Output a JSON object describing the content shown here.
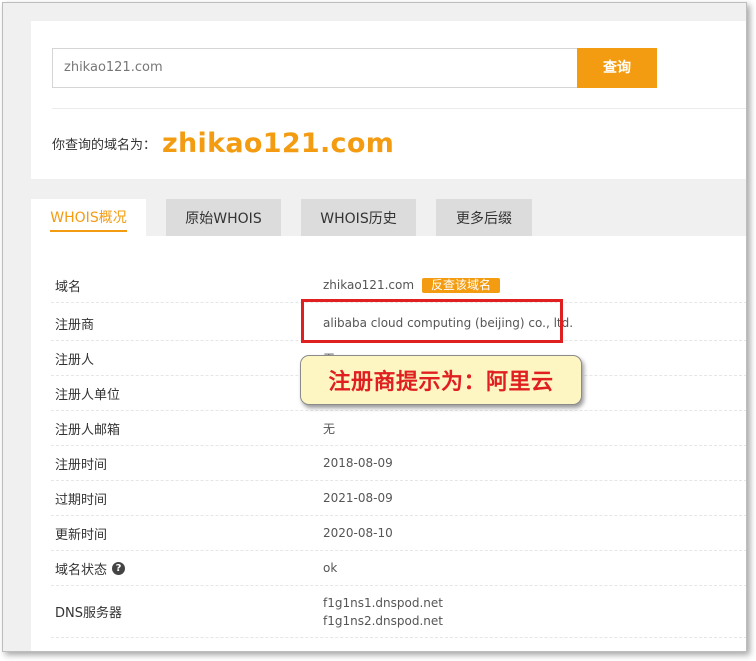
{
  "search": {
    "value": "zhikao121.com",
    "button_label": "查询"
  },
  "result": {
    "prefix": "你查询的域名为：",
    "domain": "zhikao121.com"
  },
  "tabs": [
    {
      "label": "WHOIS概况",
      "active": true
    },
    {
      "label": "原始WHOIS",
      "active": false
    },
    {
      "label": "WHOIS历史",
      "active": false
    },
    {
      "label": "更多后缀",
      "active": false
    }
  ],
  "rows": [
    {
      "label": "域名",
      "value": "zhikao121.com",
      "badge": "反查该域名"
    },
    {
      "label": "注册商",
      "value": "alibaba cloud computing (beijing) co., ltd."
    },
    {
      "label": "注册人",
      "value": "无"
    },
    {
      "label": "注册人单位",
      "value": ""
    },
    {
      "label": "注册人邮箱",
      "value": "无"
    },
    {
      "label": "注册时间",
      "value": "2018-08-09"
    },
    {
      "label": "过期时间",
      "value": "2021-08-09"
    },
    {
      "label": "更新时间",
      "value": "2020-08-10"
    },
    {
      "label": "域名状态",
      "value": "ok",
      "help": "?"
    },
    {
      "label": "DNS服务器",
      "values": [
        "f1g1ns1.dnspod.net",
        "f1g1ns2.dnspod.net"
      ]
    }
  ],
  "annotation": {
    "callout_text": "注册商提示为：阿里云"
  },
  "colors": {
    "accent": "#f39c12",
    "annotation_red": "#e02020",
    "callout_bg": "#fdf6c3"
  }
}
